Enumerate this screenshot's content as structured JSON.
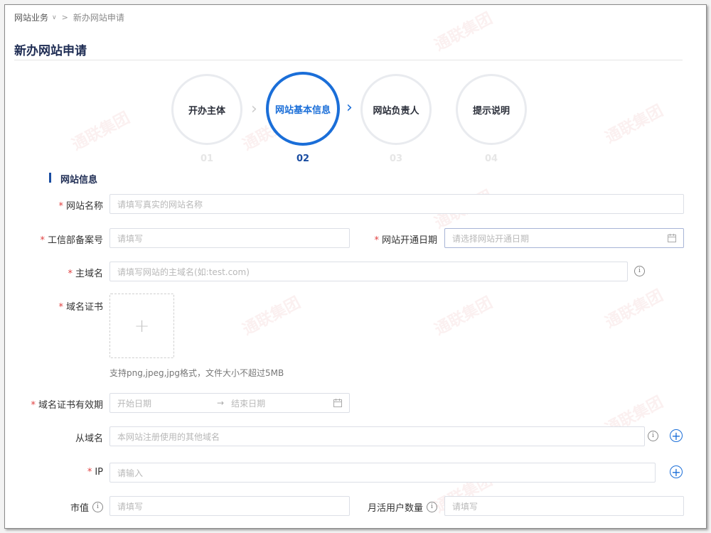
{
  "breadcrumb": {
    "parent": "网站业务",
    "current": "新办网站申请"
  },
  "page_title": "新办网站申请",
  "steps": [
    {
      "label": "开办主体",
      "num": "01"
    },
    {
      "label": "网站基本信息",
      "num": "02"
    },
    {
      "label": "网站负责人",
      "num": "03"
    },
    {
      "label": "提示说明",
      "num": "04"
    }
  ],
  "active_step": 2,
  "section_title": "网站信息",
  "form": {
    "site_name": {
      "label": "网站名称",
      "placeholder": "请填写真实的网站名称"
    },
    "icp": {
      "label": "工信部备案号",
      "placeholder": "请填写"
    },
    "open_date": {
      "label": "网站开通日期",
      "placeholder": "请选择网站开通日期"
    },
    "main_domain": {
      "label": "主域名",
      "placeholder": "请填写网站的主域名(如:test.com)"
    },
    "cert": {
      "label": "域名证书",
      "hint": "支持png,jpeg,jpg格式，文件大小不超过5MB"
    },
    "cert_validity": {
      "label": "域名证书有效期",
      "start": "开始日期",
      "end": "结束日期"
    },
    "sub_domain": {
      "label": "从域名",
      "placeholder": "本网站注册使用的其他域名"
    },
    "ip": {
      "label": "IP",
      "placeholder": "请输入"
    },
    "market_value": {
      "label": "市值",
      "placeholder": "请填写"
    },
    "mau": {
      "label": "月活用户数量",
      "placeholder": "请填写"
    }
  },
  "watermark_text": "通联集团",
  "colors": {
    "primary": "#1a6ed8",
    "required": "#e04040",
    "title": "#1f2d54"
  }
}
